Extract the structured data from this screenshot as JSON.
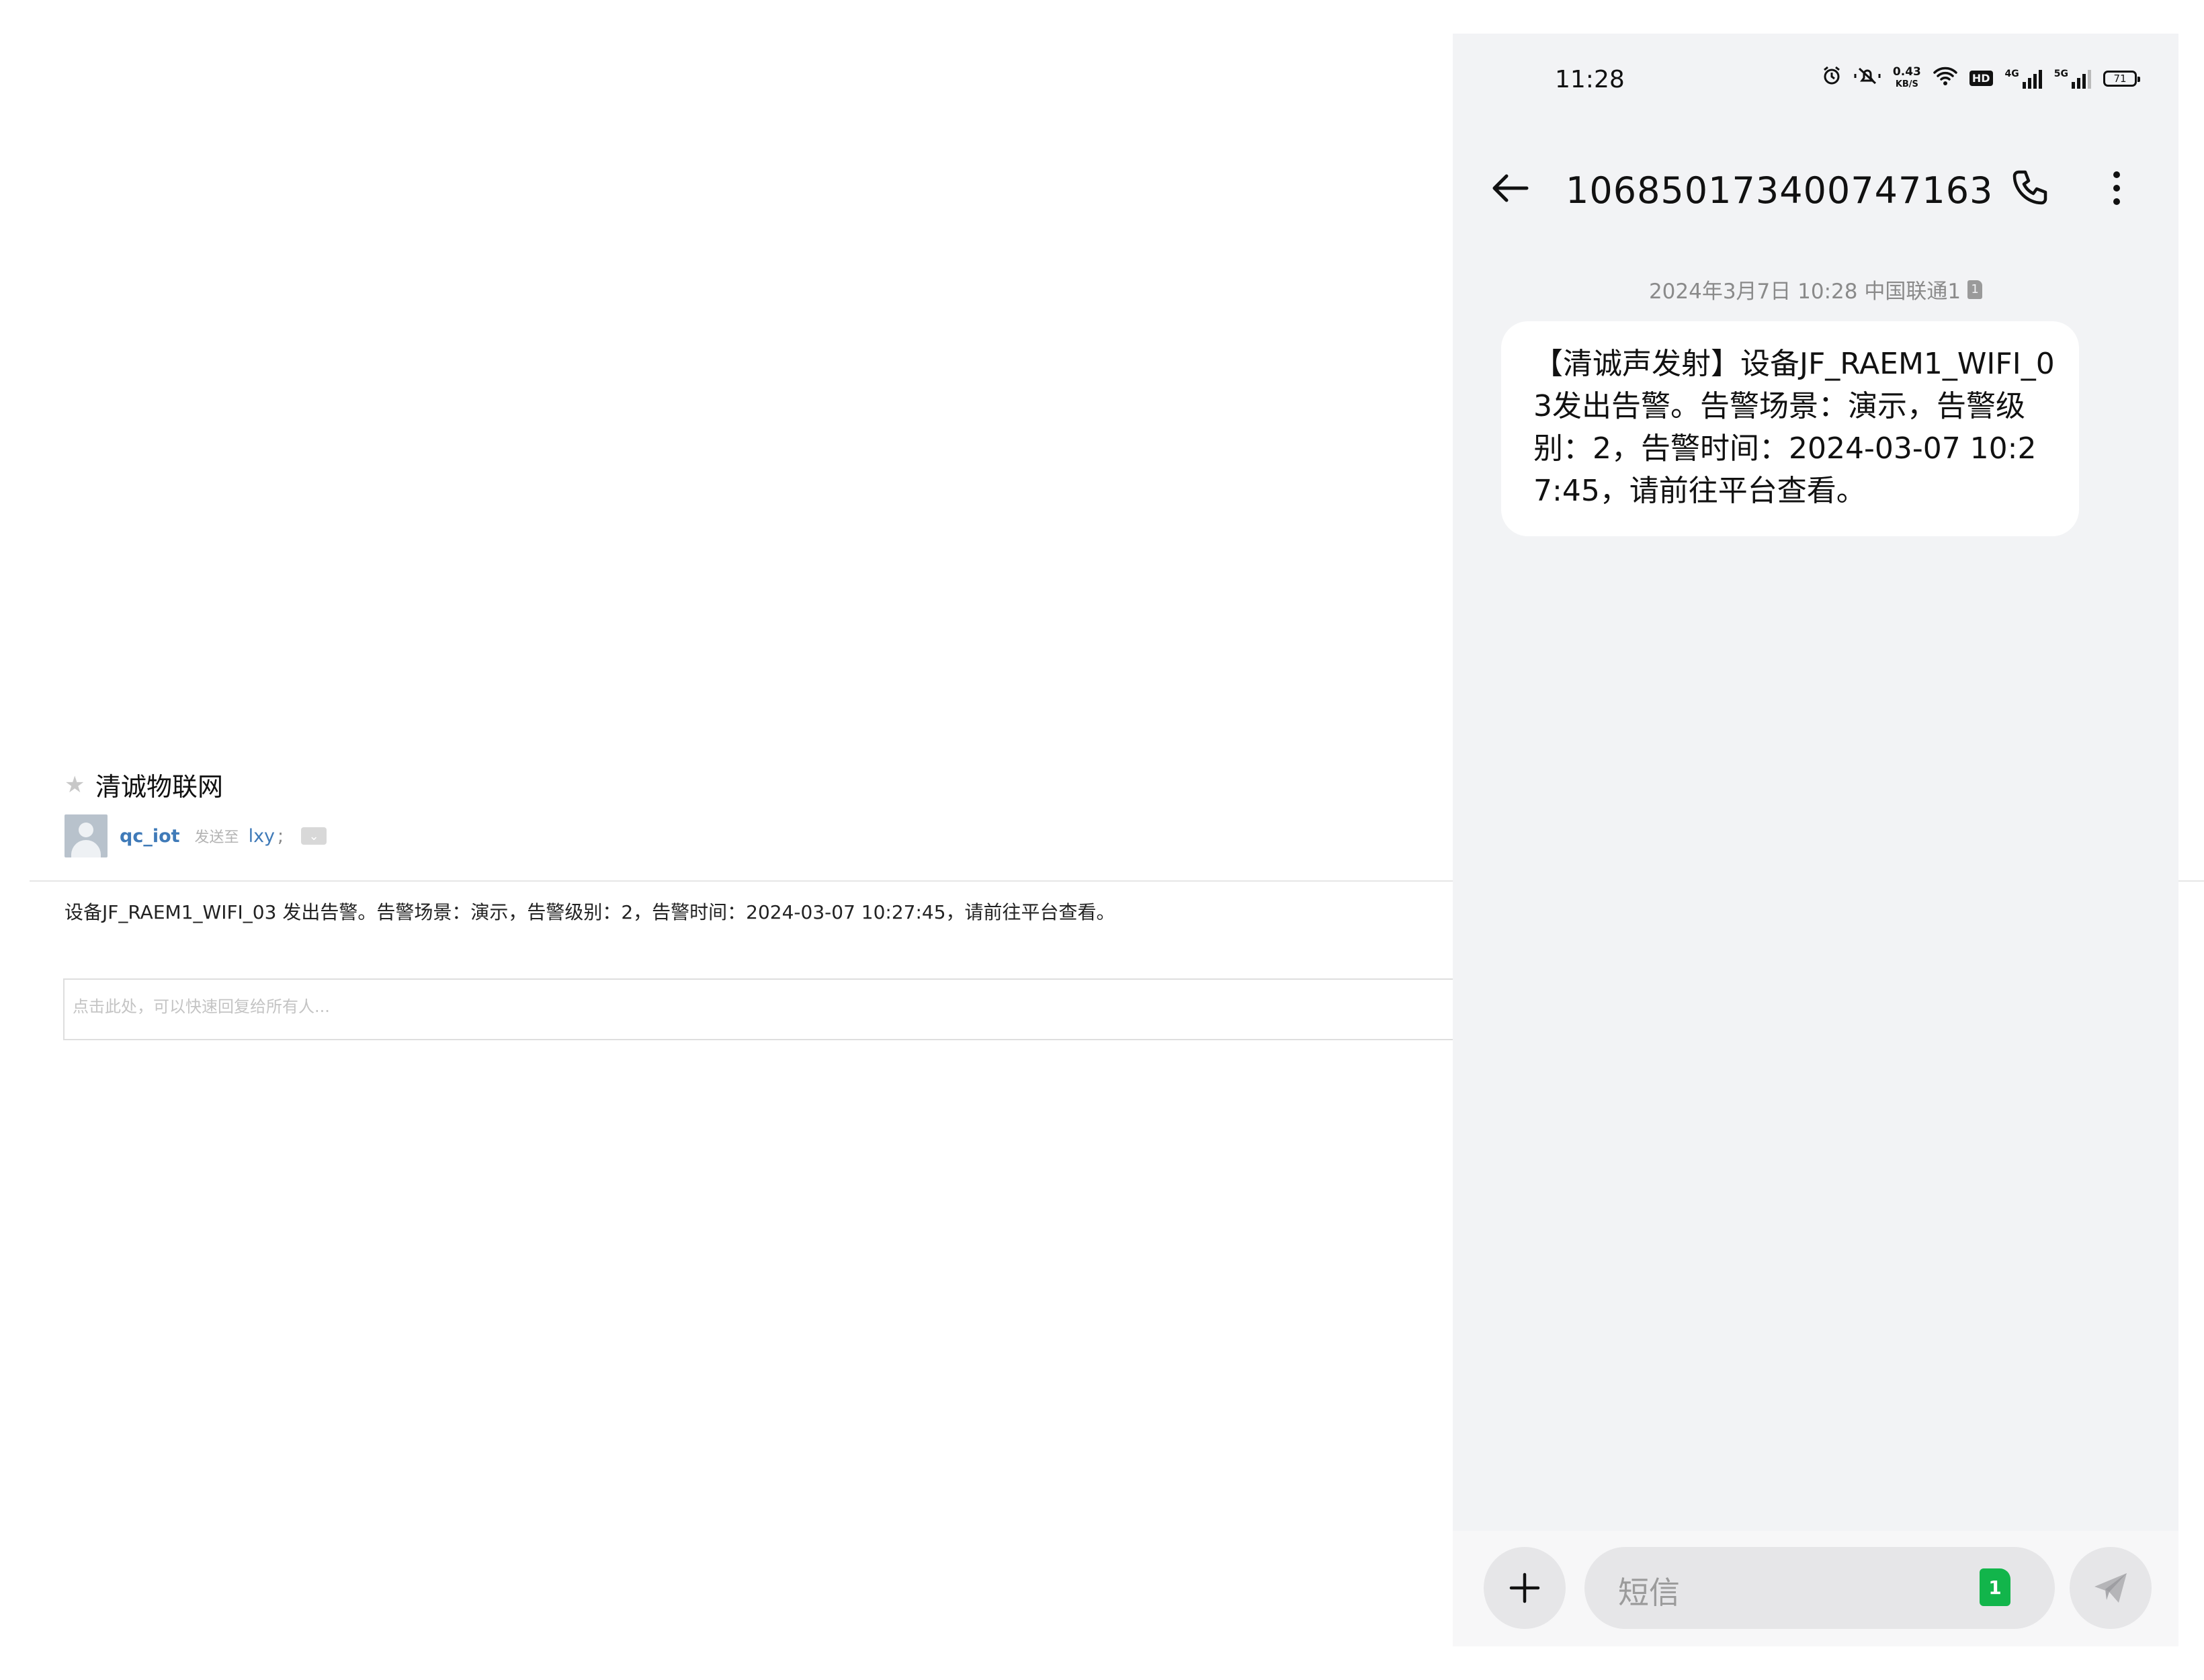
{
  "email": {
    "subject": "清诚物联网",
    "sender": "qc_iot",
    "sent_to_label": "发送至",
    "recipient": "lxy",
    "recipient_separator": ";",
    "body": "设备JF_RAEM1_WIFI_03 发出告警。告警场景：演示，告警级别：2，告警时间：2024-03-07 10:27:45，请前往平台查看。",
    "reply_placeholder": "点击此处，可以快速回复给所有人..."
  },
  "phone": {
    "status_bar": {
      "time": "11:28",
      "speed_value": "0.43",
      "speed_unit": "KB/S",
      "hd_label": "HD",
      "network_1": "4G",
      "network_2": "5G",
      "battery": "71"
    },
    "header": {
      "contact": "106850173400747163"
    },
    "message": {
      "meta": "2024年3月7日 10:28 中国联通1",
      "sim_label": "1",
      "text": "【清诚声发射】设备JF_RAEM1_WIFI_03发出告警。告警场景：演示，告警级别：2，告警时间：2024-03-07 10:27:45，请前往平台查看。"
    },
    "composer": {
      "placeholder": "短信",
      "sim_badge": "1"
    },
    "colors": {
      "background": "#f2f3f5",
      "bubble": "#ffffff",
      "sim_green": "#12b54b"
    }
  }
}
